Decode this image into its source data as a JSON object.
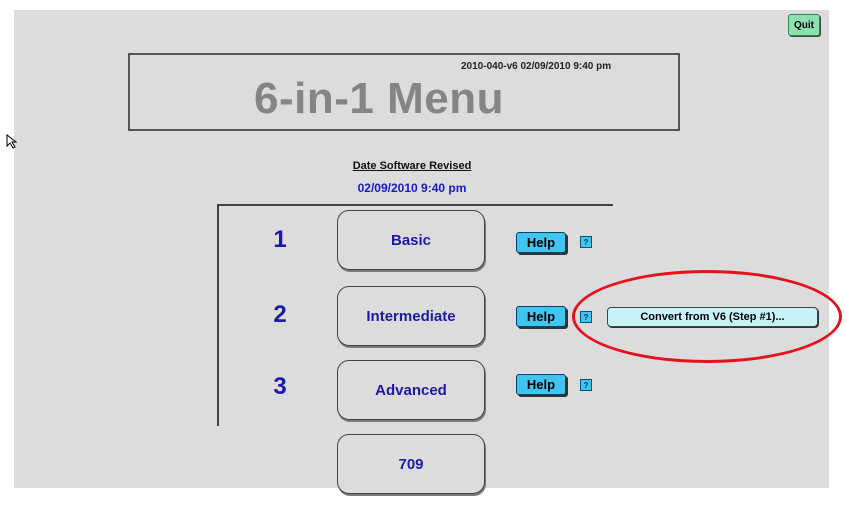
{
  "header": {
    "quit_label": "Quit",
    "title": "6-in-1 Menu",
    "version": "2010-040-v6 02/09/2010 9:40 pm"
  },
  "revision": {
    "label": "Date Software Revised",
    "date": "02/09/2010 9:40 pm"
  },
  "menu": {
    "items": [
      {
        "number": "1",
        "label": "Basic",
        "help": "Help",
        "q": "?"
      },
      {
        "number": "2",
        "label": "Intermediate",
        "help": "Help",
        "q": "?"
      },
      {
        "number": "3",
        "label": "Advanced",
        "help": "Help",
        "q": "?"
      }
    ],
    "extra_label": "709"
  },
  "convert": {
    "label": "Convert from V6 (Step #1)..."
  },
  "annotation": {
    "color": "#e4121d"
  },
  "icons": {
    "cursor": "mouse-pointer-icon"
  }
}
